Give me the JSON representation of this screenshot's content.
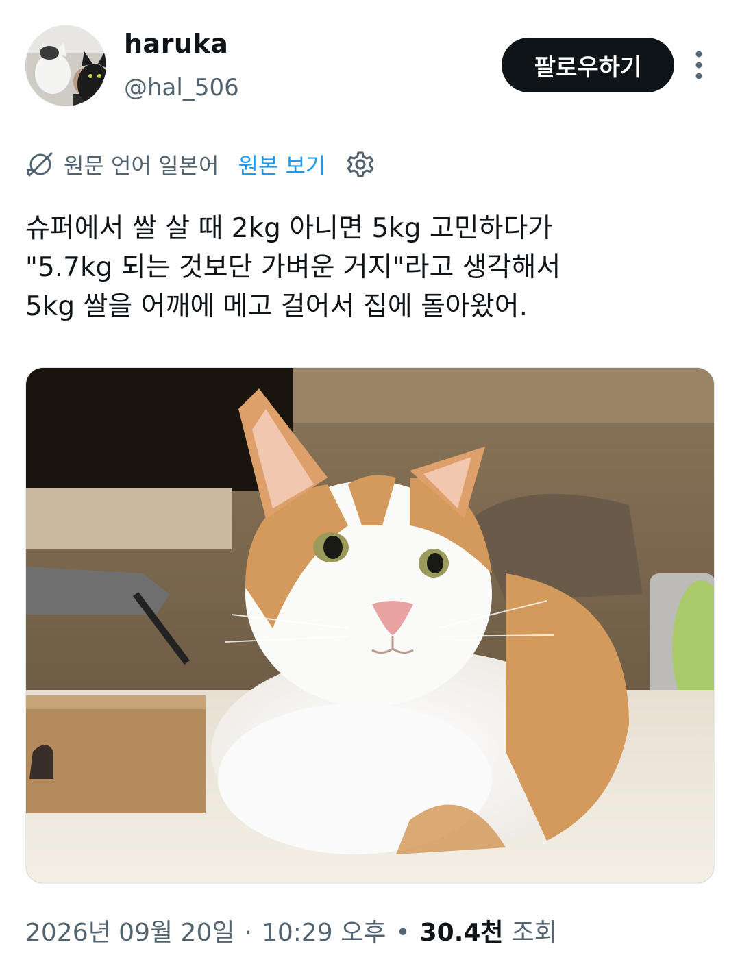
{
  "author": {
    "display_name": "haruka",
    "handle": "@hal_506"
  },
  "follow_button_label": "팔로우하기",
  "translation": {
    "language_label": "원문 언어 일본어",
    "show_original_label": "원본 보기"
  },
  "tweet": {
    "lines": [
      "슈퍼에서 쌀 살 때 2kg 아니면 5kg 고민하다가",
      "\"5.7kg 되는 것보단 가벼운 거지\"라고 생각해서",
      "5kg 쌀을 어깨에 메고 걸어서 집에 돌아왔어."
    ]
  },
  "meta": {
    "date": "2026년 09월 20일",
    "separator_dot": "·",
    "time": "10:29 오후",
    "bullet": "•",
    "views_count": "30.4천",
    "views_label": "조회"
  },
  "colors": {
    "text_primary": "#0f1419",
    "text_secondary": "#536471",
    "link_blue": "#1d9bf0",
    "button_bg": "#0f1419"
  }
}
